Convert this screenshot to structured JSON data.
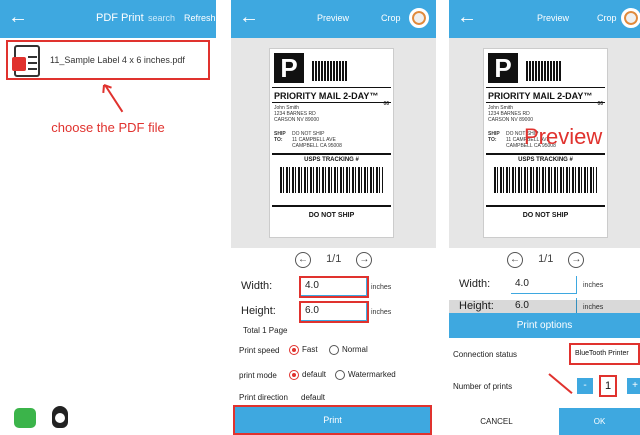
{
  "panel1": {
    "header": {
      "title": "PDF Print",
      "search": "search",
      "refresh": "Refresh"
    },
    "file_name": "11_Sample Label 4 x 6 inches.pdf",
    "caption": "choose the PDF file"
  },
  "panel2": {
    "header": {
      "title": "Preview",
      "crop": "Crop"
    },
    "label": {
      "mail_class": "PRIORITY MAIL 2-DAY™",
      "zone": "06",
      "from": "John Smith\n1234 BARNES RD\nCARSON NV 89000",
      "ship_to_tag": "SHIP\nTO:",
      "to": "DO NOT SHIP\n11 CAMPBELL AVE\nCAMPBELL CA 95008",
      "tracking": "USPS TRACKING #",
      "footer": "DO NOT SHIP"
    },
    "page_nav": "1/1",
    "width_label": "Width:",
    "width_value": "4.0",
    "height_label": "Height:",
    "height_value": "6.0",
    "unit": "inches",
    "total": "Total 1 Page",
    "speed_label": "Print speed",
    "speed_fast": "Fast",
    "speed_normal": "Normal",
    "mode_label": "print mode",
    "mode_default": "default",
    "mode_watermarked": "Watermarked",
    "direction_label": "Print direction",
    "direction_value": "default",
    "print_button": "Print"
  },
  "panel3": {
    "header": {
      "title": "Preview",
      "crop": "Crop"
    },
    "overlay": "Preview",
    "page_nav": "1/1",
    "width_label": "Width:",
    "width_value": "4.0",
    "height_label": "Height:",
    "height_value": "6.0",
    "unit": "inches",
    "dialog": {
      "title": "Print options",
      "connection_label": "Connection status",
      "connection_value": "BlueTooth Printer",
      "prints_label": "Number of prints",
      "minus": "-",
      "count": "1",
      "plus": "+",
      "cancel": "CANCEL",
      "ok": "OK"
    }
  },
  "colors": {
    "accent": "#3ea8e0",
    "highlight": "#e0322e"
  }
}
